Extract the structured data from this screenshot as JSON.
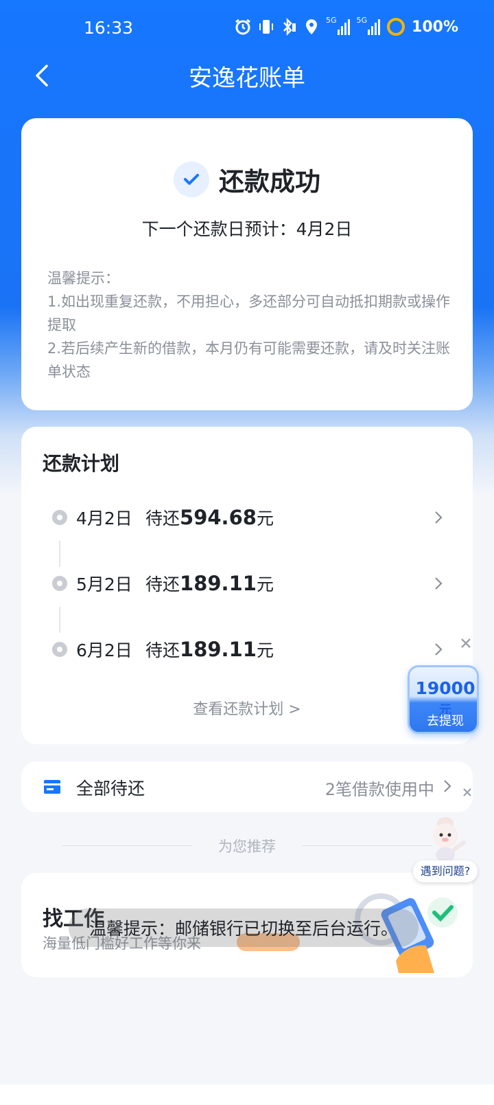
{
  "status_bar": {
    "time": "16:33",
    "battery": "100%",
    "net1": "5G",
    "net2": "5G"
  },
  "header": {
    "title": "安逸花账单"
  },
  "success": {
    "title": "还款成功",
    "next_date_text": "下一个还款日预计：4月2日",
    "tips_heading": "温馨提示：",
    "tip1": "1.如出现重复还款，不用担心，多还部分可自动抵扣期款或操作提取",
    "tip2": "2.若后续产生新的借款，本月仍有可能需要还款，请及时关注账单状态"
  },
  "plan": {
    "title": "还款计划",
    "items": [
      {
        "date": "4月2日",
        "prefix": "待还",
        "amount": "594.68",
        "unit": "元"
      },
      {
        "date": "5月2日",
        "prefix": "待还",
        "amount": "189.11",
        "unit": "元"
      },
      {
        "date": "6月2日",
        "prefix": "待还",
        "amount": "189.11",
        "unit": "元"
      }
    ],
    "view_all": "查看还款计划 >"
  },
  "all_pending": {
    "label": "全部待还",
    "status": "2笔借款使用中"
  },
  "recommend": {
    "title": "为您推荐"
  },
  "job": {
    "title": "找工作",
    "subtitle": "海量低门槛好工作等你来"
  },
  "withdraw": {
    "amount": "19000",
    "unit": "元",
    "label": "去提现"
  },
  "help": {
    "label": "遇到问题?"
  },
  "toast": {
    "text": "温馨提示：邮储银行已切换至后台运行。"
  },
  "colors": {
    "primary": "#1677ff",
    "card": "#ffffff",
    "muted": "#8a8f99"
  }
}
